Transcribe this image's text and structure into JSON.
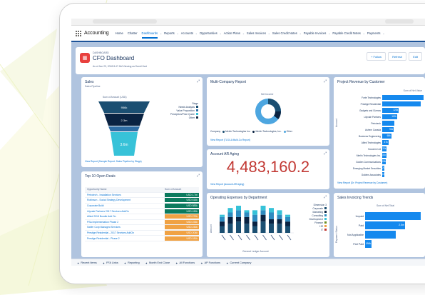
{
  "nav": {
    "app_name": "Accounting",
    "items": [
      "Home",
      "Chatter",
      "Dashboards",
      "Reports",
      "Accounts",
      "Opportunities",
      "Action Plans",
      "Sales Invoices",
      "Sales Credit Notes",
      "Payable Invoices",
      "Payable Credit Notes",
      "Payments"
    ],
    "active_index": 2
  },
  "dashboard": {
    "kicker": "DASHBOARD",
    "title": "CFO Dashboard",
    "as_of": "As of Jan 23, 2018 8:47 AM Viewing as David Hart",
    "buttons": [
      "+ Follow",
      "Refresh",
      "Edit"
    ]
  },
  "sales": {
    "title": "Sales",
    "subtitle": "Sales Pipeline",
    "measure": "Sum of Amount (USD)",
    "legend_title": "Stage",
    "legend": [
      {
        "label": "Needs Analysis",
        "color": "#1b4f72"
      },
      {
        "label": "Value Proposition",
        "color": "#2e6da4"
      },
      {
        "label": "Perception/Price Quote",
        "color": "#37c2d8"
      },
      {
        "label": "Other",
        "color": "#1a2e48"
      }
    ],
    "funnel_values": [
      "956k",
      "2.3m",
      "",
      "3.6m"
    ],
    "link": "View Report (Sample Report: Sales Pipeline by Stage)"
  },
  "multi_company": {
    "title": "Multi-Company Report",
    "measure": "Net Income",
    "legend_prefix": "Company",
    "legend": [
      {
        "label": "Merlin Technologies Inc.",
        "color": "#1b4f72"
      },
      {
        "label": "Merlin Technologies, Inc.",
        "color": "#0a2342"
      },
      {
        "label": "Other",
        "color": "#4da6e0"
      }
    ],
    "link": "View Report (TLS/LA Multi-Co Report)"
  },
  "project_revenue": {
    "title": "Project Revenue by Customer",
    "measure": "Sum of Net Value",
    "ylabel": "Account",
    "rows": [
      {
        "label": "Forte Technologies",
        "value": "",
        "pct": 1.0
      },
      {
        "label": "Prestige Residential",
        "value": "",
        "pct": 0.93
      },
      {
        "label": "Gadgets and Gizmos",
        "value": "123k",
        "pct": 0.4
      },
      {
        "label": "Lilyvale Partners",
        "value": "112k",
        "pct": 0.36
      },
      {
        "label": "Petrotech",
        "value": "",
        "pct": 0.3
      },
      {
        "label": "Ashem Canada",
        "value": "94k",
        "pct": 0.28
      },
      {
        "label": "Business Engineering",
        "value": "68k",
        "pct": 0.22
      },
      {
        "label": "Allied Technologies",
        "value": "47k",
        "pct": 0.15
      },
      {
        "label": "Socomm Ltd",
        "value": "33k",
        "pct": 0.11
      },
      {
        "label": "Merlin Technologies Inc.",
        "value": "31k",
        "pct": 0.1
      },
      {
        "label": "Golden Communications",
        "value": "24k",
        "pct": 0.08
      },
      {
        "label": "Emerging Market Securities",
        "value": "20k",
        "pct": 0.06
      },
      {
        "label": "Golders Associates",
        "value": "15k",
        "pct": 0.05
      }
    ],
    "link": "View Report (Dr: Project Revenue by Customer)"
  },
  "ar_aging": {
    "title": "Account AR Aging",
    "value": "4,483,160.2",
    "link": "View Report (Account AR Aging)"
  },
  "open_deals": {
    "title": "Top 10 Open Deals",
    "col_name": "Opportunity Name",
    "col_value": "Sum of Amount",
    "rows": [
      {
        "name": "Petrotech - Installation Services",
        "value": "USD 1.7m",
        "color": "#0b7a5e"
      },
      {
        "name": "Robinson - Social Strategy Development",
        "value": "USD 615k",
        "color": "#0b7a5e"
      },
      {
        "name": "Corporate Build",
        "value": "USD 583k",
        "color": "#0b7a5e"
      },
      {
        "name": "Lilyvale Partners 2017 Services AddOn",
        "value": "USD 430k",
        "color": "#0b7a5e"
      },
      {
        "name": "Allied 2018 Bundle Add On",
        "value": "USD 270k",
        "color": "#f0a244"
      },
      {
        "name": "PSA Implementation Phase 2",
        "value": "USD 233k",
        "color": "#f0a244"
      },
      {
        "name": "Swifer Corp Managed Services",
        "value": "USD 230k",
        "color": "#f0a244"
      },
      {
        "name": "Prestige Residential - 2017 Services AddOn",
        "value": "USD 204k",
        "color": "#f0a244"
      },
      {
        "name": "Prestige Residential - Phase 2",
        "value": "USD 181k",
        "color": "#f0a244"
      }
    ]
  },
  "opex": {
    "title": "Operating Expenses by Department",
    "ylabel": "Amount",
    "xlabel": "General Ledger Account",
    "legend_title": "Dimension 3",
    "legend": [
      {
        "label": "Corporate",
        "color": "#1b4f72"
      },
      {
        "label": "Marketing",
        "color": "#0a2342"
      },
      {
        "label": "Consulting",
        "color": "#2e8bc0"
      },
      {
        "label": "Development",
        "color": "#37c2d8"
      },
      {
        "label": "Finance",
        "color": "#6b8e23"
      },
      {
        "label": "HR",
        "color": "#f0a244"
      },
      {
        "label": "IT",
        "color": "#c23934"
      }
    ],
    "chart_data": {
      "type": "bar",
      "categories": [
        "",
        "",
        "",
        "",
        "",
        "",
        "",
        "",
        ""
      ],
      "series": [
        {
          "name": "Corporate",
          "values": [
            3,
            4,
            5,
            4,
            3,
            5,
            4,
            4,
            3
          ]
        },
        {
          "name": "Marketing",
          "values": [
            2,
            3,
            2,
            3,
            2,
            3,
            2,
            2,
            2
          ]
        },
        {
          "name": "Consulting",
          "values": [
            2,
            2,
            3,
            2,
            3,
            2,
            3,
            2,
            2
          ]
        },
        {
          "name": "Development",
          "values": [
            1,
            2,
            2,
            1,
            2,
            2,
            2,
            2,
            1
          ]
        }
      ]
    }
  },
  "invoicing": {
    "title": "Sales Invoicing Trends",
    "measure": "Sum of Net Total",
    "ylabel": "Payment Status",
    "rows": [
      {
        "label": "Unpaid",
        "value": "",
        "pct": 1.0
      },
      {
        "label": "Paid",
        "value": "2.5m",
        "pct": 0.72
      },
      {
        "label": "Not Applicable",
        "value": "",
        "pct": 0.55
      },
      {
        "label": "Part Paid",
        "value": "186k",
        "pct": 0.12
      }
    ]
  },
  "bottom_bar": [
    "Recent Items",
    "FFA Links",
    "Reporting",
    "Month End Close",
    "All Functions",
    "AP Functions",
    "Current Company"
  ]
}
